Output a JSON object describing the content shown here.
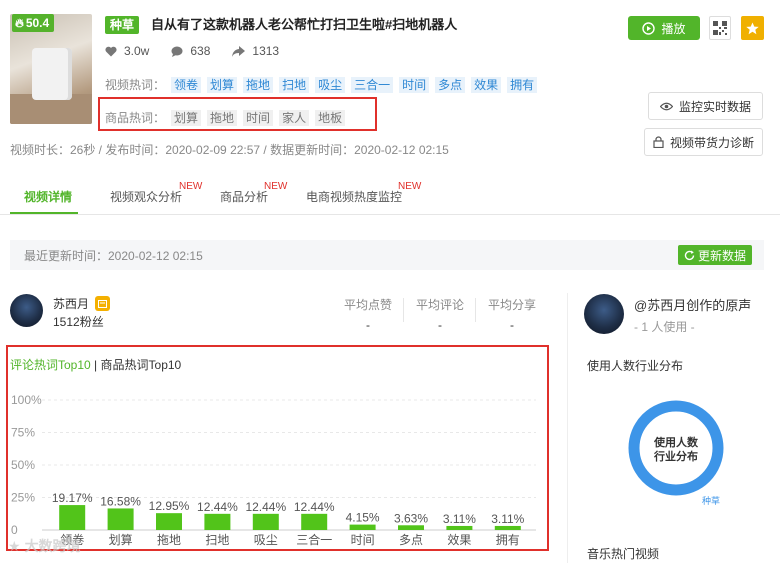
{
  "video": {
    "score": "50.4",
    "category_tag": "种草",
    "title": "自从有了这款机器人老公帮忙打扫卫生啦#扫地机器人",
    "stats": {
      "likes": "3.0w",
      "comments": "638",
      "shares": "1313"
    },
    "video_hot_label": "视频热词：",
    "video_hot_words": [
      "领卷",
      "划算",
      "拖地",
      "扫地",
      "吸尘",
      "三合一",
      "时间",
      "多点",
      "效果",
      "拥有"
    ],
    "product_hot_label": "商品热词：",
    "product_hot_words": [
      "划算",
      "拖地",
      "时间",
      "家人",
      "地板"
    ],
    "meta_line": "视频时长：26秒 / 发布时间：2020-02-09 22:57 / 数据更新时间：2020-02-12 02:15"
  },
  "actions": {
    "play_label": "播放",
    "monitor_label": "监控实时数据",
    "diagnose_label": "视频带货力诊断"
  },
  "tabs": [
    {
      "label": "视频详情",
      "active": true,
      "new": false
    },
    {
      "label": "视频观众分析",
      "active": false,
      "new": true
    },
    {
      "label": "商品分析",
      "active": false,
      "new": true
    },
    {
      "label": "电商视频热度监控",
      "active": false,
      "new": true
    }
  ],
  "new_badge": "NEW",
  "update": {
    "text": "最近更新时间：2020-02-12 02:15",
    "button_label": "更新数据"
  },
  "author": {
    "name": "苏西月",
    "fans": "1512粉丝",
    "avg": [
      {
        "label": "平均点赞",
        "value": "-"
      },
      {
        "label": "平均评论",
        "value": "-"
      },
      {
        "label": "平均分享",
        "value": "-"
      }
    ]
  },
  "chart_tabs": {
    "active": "评论热词Top10",
    "separator": "|",
    "inactive": "商品热词Top10"
  },
  "chart_data": {
    "type": "bar",
    "categories": [
      "领卷",
      "划算",
      "拖地",
      "扫地",
      "吸尘",
      "三合一",
      "时间",
      "多点",
      "效果",
      "拥有"
    ],
    "values": [
      19.17,
      16.58,
      12.95,
      12.44,
      12.44,
      12.44,
      4.15,
      3.63,
      3.11,
      3.11
    ],
    "value_labels": [
      "19.17%",
      "16.58%",
      "12.95%",
      "12.44%",
      "12.44%",
      "12.44%",
      "4.15%",
      "3.63%",
      "3.11%",
      "3.11%"
    ],
    "y_ticks": [
      "100%",
      "75%",
      "50%",
      "25%",
      "0"
    ],
    "ylim": [
      0,
      100
    ],
    "bar_color": "#52c41a",
    "grid": true
  },
  "sidebar": {
    "sound_title": "@苏西月创作的原声",
    "sound_sub": "- 1 人使用 -",
    "industry_title": "使用人数行业分布",
    "donut_center": [
      "使用人数",
      "行业分布"
    ],
    "donut_label": "种草",
    "donut_color": "#3d95e8",
    "music_title": "音乐热门视频"
  },
  "watermark": "大数跨境"
}
